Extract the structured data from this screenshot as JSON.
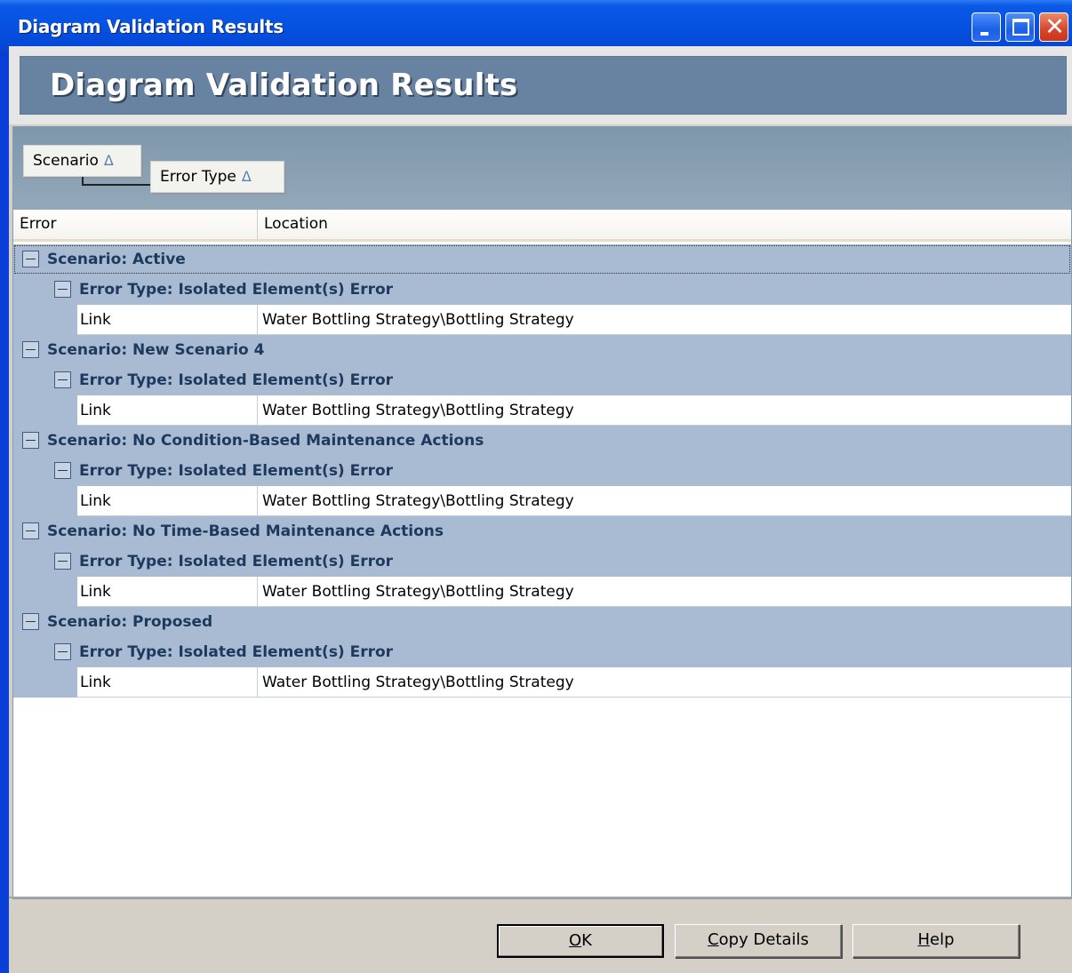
{
  "window": {
    "title": "Diagram Validation Results"
  },
  "banner": {
    "title": "Diagram Validation Results"
  },
  "grouping": {
    "chips": [
      {
        "label": "Scenario",
        "sort_glyph": "Δ"
      },
      {
        "label": "Error Type",
        "sort_glyph": "Δ"
      }
    ]
  },
  "columns": {
    "error": "Error",
    "location": "Location"
  },
  "groups": [
    {
      "scenario": "Scenario: Active",
      "error_type": "Error Type: Isolated Element(s) Error",
      "row": {
        "error": "Link",
        "location": "Water Bottling Strategy\\Bottling Strategy"
      }
    },
    {
      "scenario": "Scenario: New Scenario 4",
      "error_type": "Error Type: Isolated Element(s) Error",
      "row": {
        "error": "Link",
        "location": "Water Bottling Strategy\\Bottling Strategy"
      }
    },
    {
      "scenario": "Scenario: No Condition-Based Maintenance Actions",
      "error_type": "Error Type: Isolated Element(s) Error",
      "row": {
        "error": "Link",
        "location": "Water Bottling Strategy\\Bottling Strategy"
      }
    },
    {
      "scenario": "Scenario: No Time-Based Maintenance Actions",
      "error_type": "Error Type: Isolated Element(s) Error",
      "row": {
        "error": "Link",
        "location": "Water Bottling Strategy\\Bottling Strategy"
      }
    },
    {
      "scenario": "Scenario: Proposed",
      "error_type": "Error Type: Isolated Element(s) Error",
      "row": {
        "error": "Link",
        "location": "Water Bottling Strategy\\Bottling Strategy"
      }
    }
  ],
  "buttons": {
    "ok": {
      "label": "OK",
      "mnemonic": "O",
      "rest": "K"
    },
    "copy": {
      "label": "Copy Details",
      "mnemonic": "C",
      "rest": "opy Details"
    },
    "help": {
      "label": "Help",
      "mnemonic": "H",
      "rest": "elp"
    }
  },
  "icons": {
    "minimize": "minimize-icon",
    "maximize": "maximize-icon",
    "close": "close-icon",
    "expander": "collapse-minus-icon",
    "sort": "sort-ascending-icon"
  },
  "colors": {
    "titlebar": "#0651e0",
    "banner": "#6783a1",
    "group_row": "#a9bbd2"
  }
}
